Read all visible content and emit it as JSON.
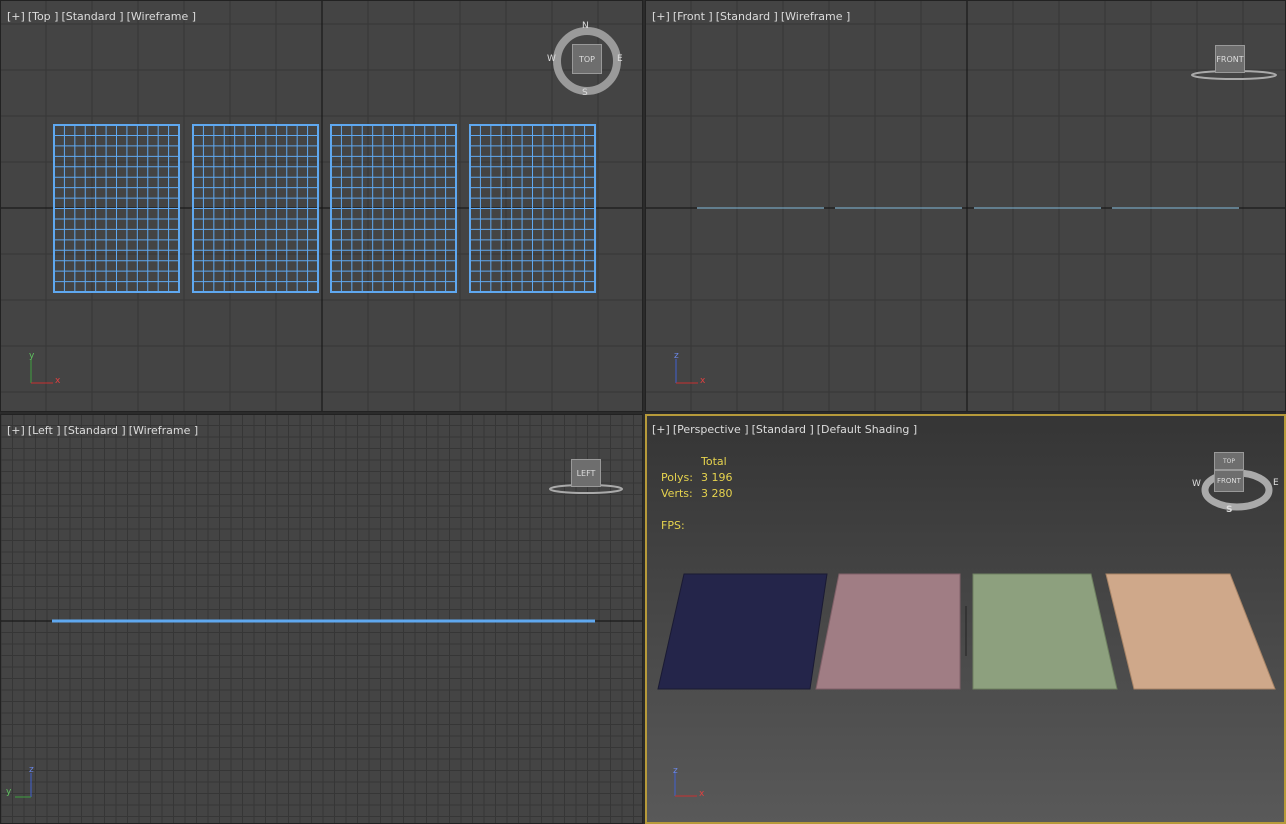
{
  "viewports": {
    "top": {
      "labels": [
        "[+]",
        "[Top ]",
        "[Standard ]",
        "[Wireframe ]"
      ],
      "cube": "TOP",
      "compass": {
        "n": "N",
        "s": "S",
        "e": "E",
        "w": "W"
      },
      "axes": {
        "v": "y",
        "h": "x"
      }
    },
    "front": {
      "labels": [
        "[+]",
        "[Front ]",
        "[Standard ]",
        "[Wireframe ]"
      ],
      "cube": "FRONT",
      "axes": {
        "v": "z",
        "h": "x"
      }
    },
    "left": {
      "labels": [
        "[+]",
        "[Left ]",
        "[Standard ]",
        "[Wireframe ]"
      ],
      "cube": "LEFT",
      "axes": {
        "v": "z",
        "h": "y"
      }
    },
    "perspective": {
      "labels": [
        "[+]",
        "[Perspective ]",
        "[Standard ]",
        "[Default Shading ]"
      ],
      "cube_top": "TOP",
      "cube_front": "FRONT",
      "compass": {
        "s": "S",
        "e": "E",
        "w": "W"
      },
      "stats": {
        "header": "Total",
        "polys_label": "Polys:",
        "polys_value": "3 196",
        "verts_label": "Verts:",
        "verts_value": "3 280",
        "fps_label": "FPS:"
      },
      "axes": {
        "v": "z",
        "h": "x"
      }
    }
  },
  "colors": {
    "wire": "#5fa8f0",
    "selected_border": "#b69a3a",
    "rug_navy": "#24254a",
    "rug_pink": "#a07d84",
    "rug_green": "#8da07e",
    "rug_beige": "#cfa88a",
    "stats_text": "#e6d34e"
  }
}
